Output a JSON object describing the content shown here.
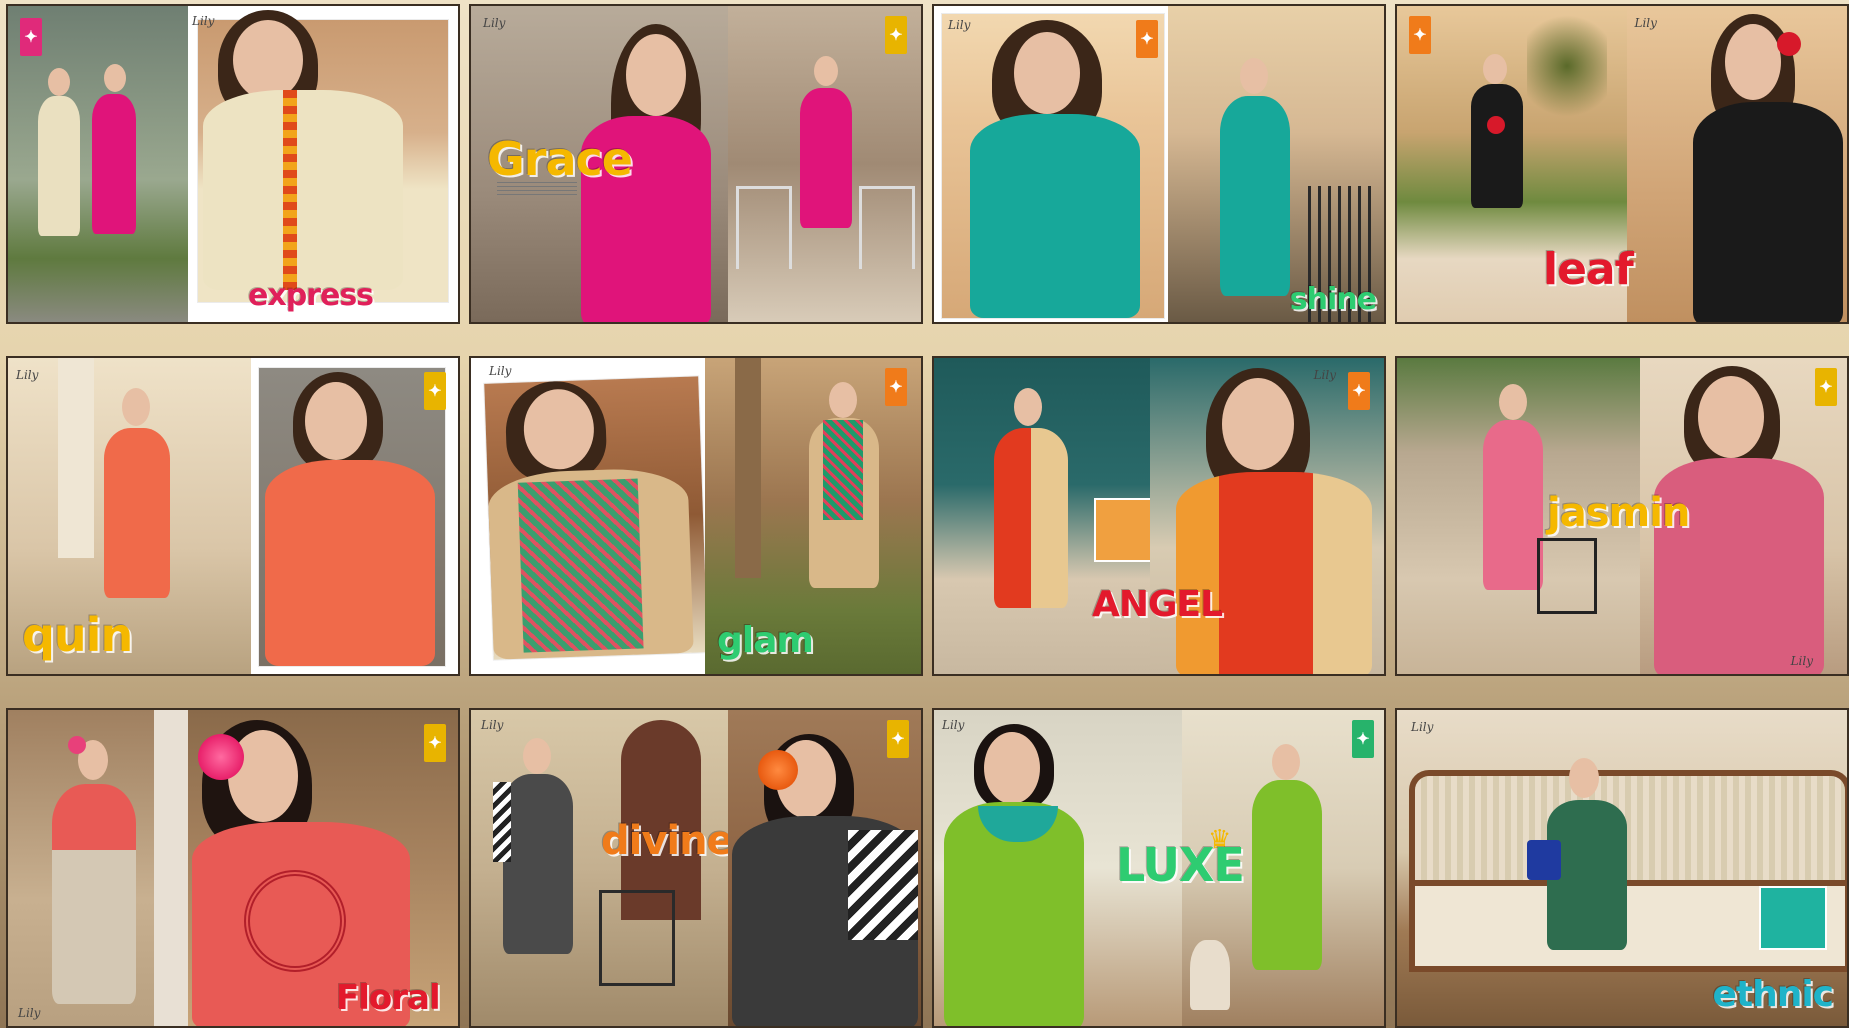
{
  "catalog": {
    "tiles": [
      {
        "label": "express",
        "label_color": "#e0205a",
        "accent": "#e83e8c",
        "badge_color": "#e02a7a",
        "signature": "Lily"
      },
      {
        "label": "Grace",
        "label_color": "#f5b800",
        "accent": "#e0147a",
        "badge_color": "#e8b400",
        "signature": "Lily"
      },
      {
        "label": "shine",
        "label_color": "#2ecc71",
        "accent": "#17a89a",
        "badge_color": "#f07b1a",
        "signature": "Lily"
      },
      {
        "label": "leaf",
        "label_color": "#e3192c",
        "accent": "#1a1a1a",
        "badge_color": "#f07b1a",
        "signature": "Lily"
      },
      {
        "label": "quin",
        "label_color": "#f5b800",
        "accent": "#f06a4a",
        "badge_color": "#e8b400",
        "signature": "Lily"
      },
      {
        "label": "glam",
        "label_color": "#2ecc71",
        "accent": "#d9b889",
        "badge_color": "#f07b1a",
        "signature": "Lily"
      },
      {
        "label": "ANGEL",
        "label_color": "#e3192c",
        "accent": "#e23a1f",
        "badge_color": "#f07b1a",
        "signature": "Lily"
      },
      {
        "label": "jasmin",
        "label_color": "#f5b800",
        "accent": "#d95d7d",
        "badge_color": "#e8b400",
        "signature": "Lily"
      },
      {
        "label": "Floral",
        "label_color": "#e3192c",
        "accent": "#e85a55",
        "badge_color": "#e8b400",
        "signature": "Lily"
      },
      {
        "label": "divine",
        "label_color": "#f07b1a",
        "accent": "#4a4a4a",
        "badge_color": "#e8b400",
        "signature": "Lily"
      },
      {
        "label": "LUXE",
        "label_color": "#2ecc71",
        "accent": "#7fbf2a",
        "badge_color": "#27b36b",
        "signature": "Lily"
      },
      {
        "label": "ethnic",
        "label_color": "#1fb3c9",
        "accent": "#2e6d4f",
        "badge_color": "#e8b400",
        "signature": "Lily"
      }
    ]
  }
}
